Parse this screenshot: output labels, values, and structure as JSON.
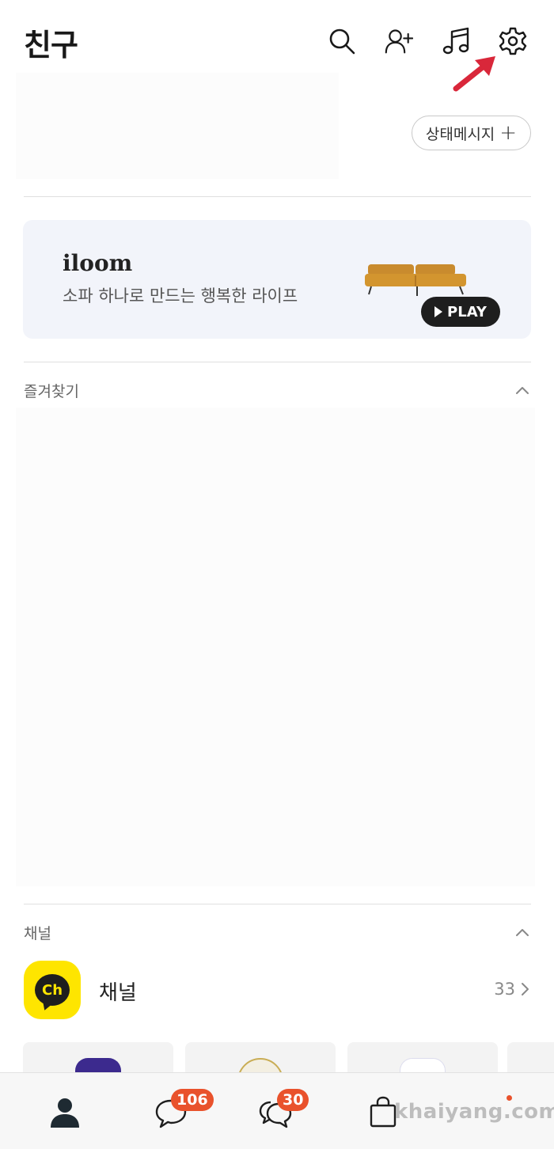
{
  "header": {
    "title": "친구",
    "icons": [
      "search-icon",
      "add-friend-icon",
      "music-icon",
      "settings-icon"
    ]
  },
  "profile": {
    "status_message_label": "상태메시지",
    "status_message_plus": "+"
  },
  "banner": {
    "brand": "iloom",
    "copy": "소파 하나로 만드는 행복한 라이프",
    "play_label": "PLAY",
    "background": "#f2f4fa"
  },
  "favorites": {
    "label": "즐겨찾기"
  },
  "channels": {
    "section_label": "채널",
    "row_name": "채널",
    "row_icon_text": "Ch",
    "row_count": "33",
    "accent": "#fee500"
  },
  "tabbar": {
    "chats_badge": "106",
    "openchat_badge": "30",
    "watermark": "khaiyang.com",
    "badge_color": "#e9522c"
  },
  "annotation": {
    "arrow_color": "#d9273a"
  }
}
